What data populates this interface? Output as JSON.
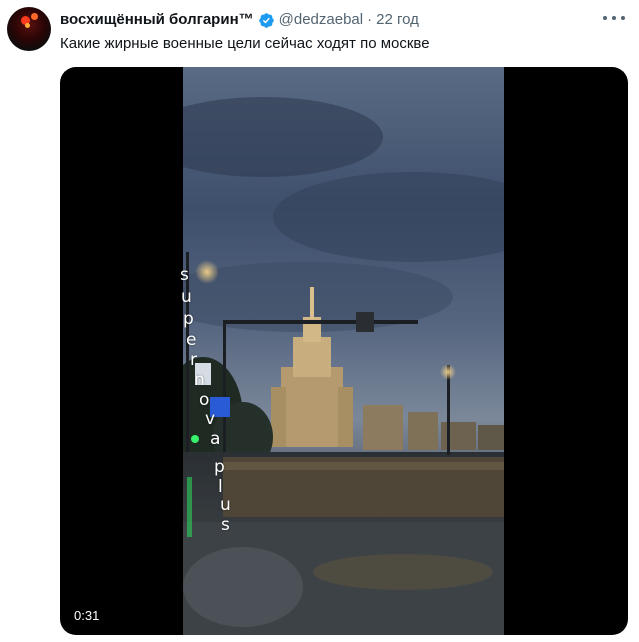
{
  "tweet": {
    "display_name": "восхищённый болгарин™",
    "handle": "@dedzaebal",
    "separator": "·",
    "time": "22 год",
    "text": "Какие жирные военные цели сейчас ходят по москве",
    "verified_icon": "verified-badge-icon",
    "more_icon": "more-horizontal-icon"
  },
  "media": {
    "duration": "0:31",
    "watermark_chars": [
      "s",
      "u",
      "p",
      "e",
      "r",
      "n",
      "o",
      "v",
      "a",
      "p",
      "l",
      "u",
      "s"
    ]
  },
  "colors": {
    "text_primary": "#0f1419",
    "text_secondary": "#536471",
    "verified": "#1d9bf0",
    "media_background": "#000000"
  }
}
